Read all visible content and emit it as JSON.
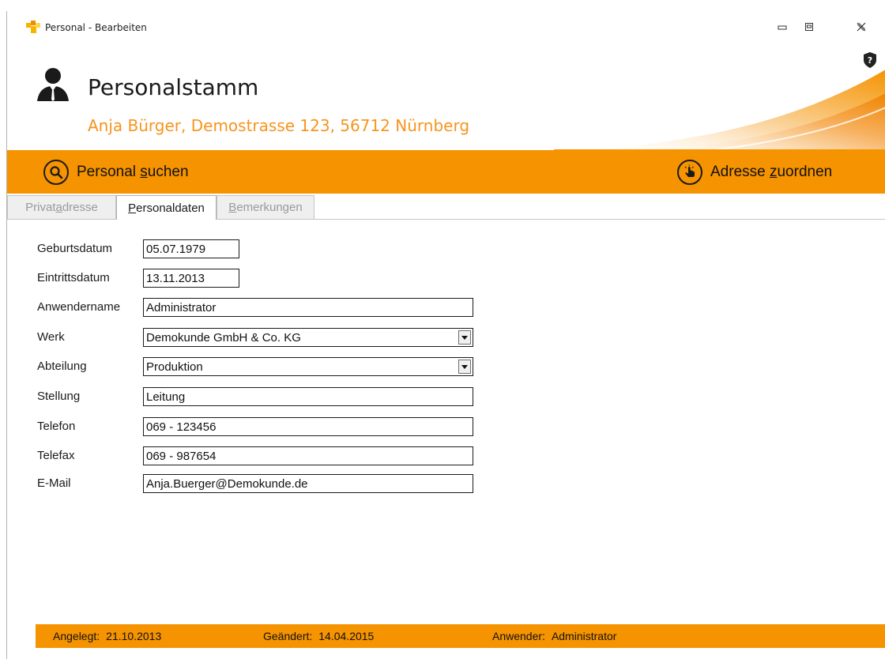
{
  "window": {
    "title": "Personal - Bearbeiten"
  },
  "header": {
    "title": "Personalstamm",
    "subtitle": "Anja Bürger, Demostrasse 123, 56712 Nürnberg"
  },
  "toolbar": {
    "search_label_pre": "Personal ",
    "search_label_key": "s",
    "search_label_post": "uchen",
    "assign_label_pre": "Adresse ",
    "assign_label_key": "z",
    "assign_label_post": "uordnen"
  },
  "tabs": [
    {
      "pre": "Privat",
      "key": "a",
      "post": "dresse",
      "active": false
    },
    {
      "pre": "",
      "key": "P",
      "post": "ersonaldaten",
      "active": true
    },
    {
      "pre": "",
      "key": "B",
      "post": "emerkungen",
      "active": false
    }
  ],
  "form": {
    "geburtsdatum": {
      "label": "Geburtsdatum",
      "value": "05.07.1979"
    },
    "eintrittsdatum": {
      "label": "Eintrittsdatum",
      "value": "13.11.2013"
    },
    "anwendername": {
      "label": "Anwendername",
      "value": "Administrator"
    },
    "werk": {
      "label": "Werk",
      "value": "Demokunde GmbH & Co. KG"
    },
    "abteilung": {
      "label": "Abteilung",
      "value": "Produktion"
    },
    "stellung": {
      "label": "Stellung",
      "value": "Leitung"
    },
    "telefon": {
      "label": "Telefon",
      "value": "069 - 123456"
    },
    "telefax": {
      "label": "Telefax",
      "value": "069 - 987654"
    },
    "email": {
      "label": "E-Mail",
      "value": "Anja.Buerger@Demokunde.de"
    }
  },
  "status": {
    "angelegt_label": "Angelegt:",
    "angelegt_value": "21.10.2013",
    "geaendert_label": "Geändert:",
    "geaendert_value": "14.04.2015",
    "anwender_label": "Anwender:",
    "anwender_value": "Administrator"
  },
  "colors": {
    "accent": "#f59300",
    "subtitle": "#f7941d"
  },
  "icons": {
    "app": "app-icon",
    "header": "person-icon",
    "help": "shield-help-icon",
    "search": "magnifier-icon",
    "assign": "pointing-hand-icon"
  }
}
